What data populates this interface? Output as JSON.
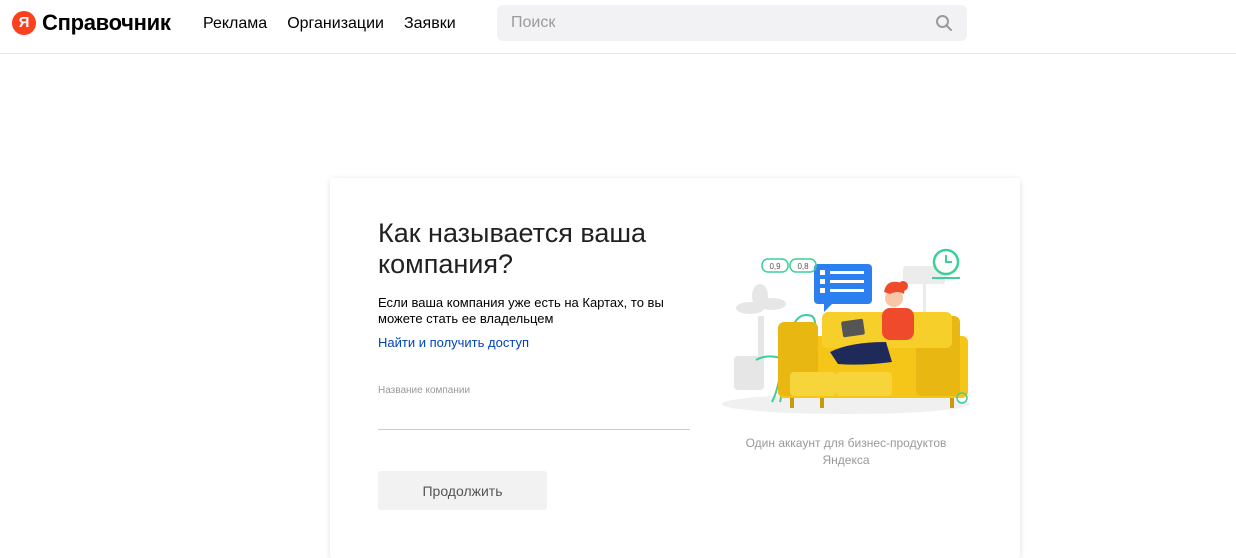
{
  "header": {
    "logo_letter": "Я",
    "logo_text": "Справочник",
    "nav": [
      {
        "label": "Реклама"
      },
      {
        "label": "Организации"
      },
      {
        "label": "Заявки"
      }
    ],
    "search": {
      "placeholder": "Поиск",
      "value": ""
    }
  },
  "card": {
    "title": "Как называется ваша компания?",
    "description": "Если ваша компания уже есть на Картах, то вы можете стать ее владельцем",
    "link": "Найти и получить доступ",
    "field": {
      "label": "Название компании",
      "value": ""
    },
    "button": "Продолжить",
    "illustration": {
      "badges": [
        "0,9",
        "0,8"
      ]
    },
    "caption": "Один аккаунт для бизнес-продуктов Яндекса"
  },
  "colors": {
    "brand_red": "#fc3f1d",
    "link_blue": "#0044bb",
    "field_underline": "#fed42b",
    "sofa_yellow": "#f5c518"
  }
}
